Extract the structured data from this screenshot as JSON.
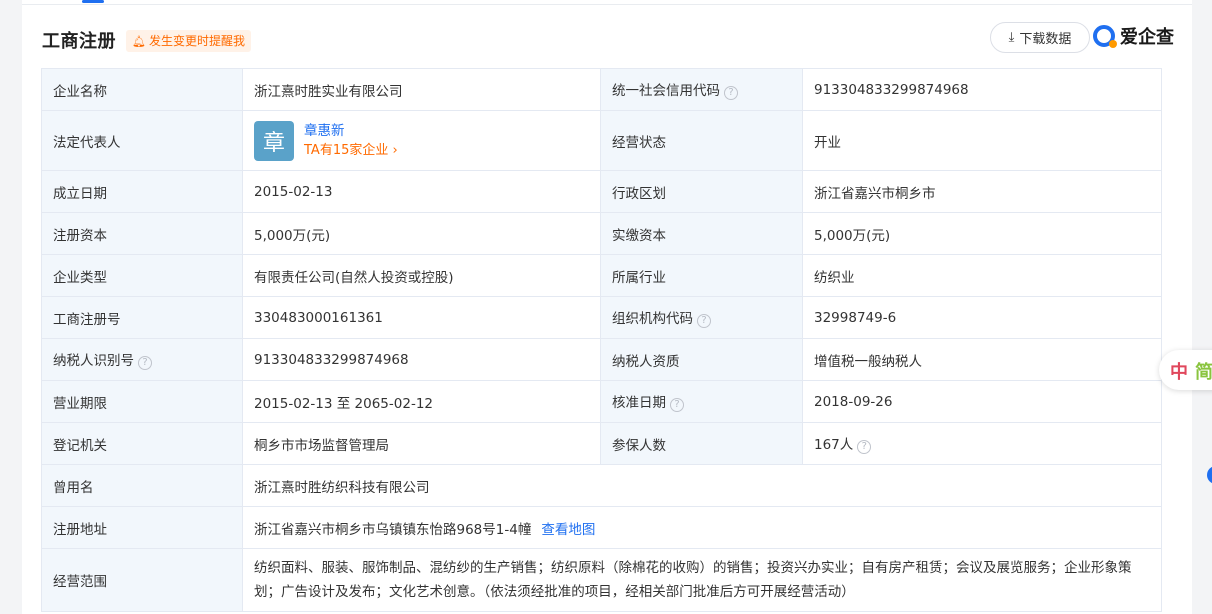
{
  "header": {
    "title": "工商注册",
    "remind": "发生变更时提醒我",
    "download": "下载数据",
    "brand": "爱企查"
  },
  "rows": {
    "company_name": {
      "label": "企业名称",
      "value": "浙江熹时胜实业有限公司"
    },
    "credit_code": {
      "label": "统一社会信用代码",
      "value": "913304833299874968"
    },
    "legal_rep": {
      "label": "法定代表人",
      "avatar_char": "章",
      "name": "章惠新",
      "ta": "TA有15家企业"
    },
    "status": {
      "label": "经营状态",
      "value": "开业"
    },
    "established": {
      "label": "成立日期",
      "value": "2015-02-13"
    },
    "region": {
      "label": "行政区划",
      "value": "浙江省嘉兴市桐乡市"
    },
    "reg_capital": {
      "label": "注册资本",
      "value": "5,000万(元)"
    },
    "paid_capital": {
      "label": "实缴资本",
      "value": "5,000万(元)"
    },
    "company_type": {
      "label": "企业类型",
      "value": "有限责任公司(自然人投资或控股)"
    },
    "industry": {
      "label": "所属行业",
      "value": "纺织业"
    },
    "reg_no": {
      "label": "工商注册号",
      "value": "330483000161361"
    },
    "org_code": {
      "label": "组织机构代码",
      "value": "32998749-6"
    },
    "taxpayer_id": {
      "label": "纳税人识别号",
      "value": "913304833299874968"
    },
    "taxpayer_qual": {
      "label": "纳税人资质",
      "value": "增值税一般纳税人"
    },
    "biz_term": {
      "label": "营业期限",
      "value": "2015-02-13 至 2065-02-12"
    },
    "approval_date": {
      "label": "核准日期",
      "value": "2018-09-26"
    },
    "authority": {
      "label": "登记机关",
      "value": "桐乡市市场监督管理局"
    },
    "insured": {
      "label": "参保人数",
      "value": "167人"
    },
    "former_name": {
      "label": "曾用名",
      "value": "浙江熹时胜纺织科技有限公司"
    },
    "address": {
      "label": "注册地址",
      "value": "浙江省嘉兴市桐乡市乌镇镇东怡路968号1-4幢",
      "map_link": "查看地图"
    },
    "scope": {
      "label": "经营范围",
      "value": "纺织面料、服装、服饰制品、混纺纱的生产销售；纺织原料（除棉花的收购）的销售；投资兴办实业；自有房产租赁；会议及展览服务；企业形象策划；广告设计及发布；文化艺术创意。（依法须经批准的项目，经相关部门批准后方可开展经营活动）"
    }
  },
  "float_widget": {
    "char1": "中",
    "char2": "简"
  },
  "colors": {
    "accent": "#1f6ff0",
    "orange": "#ff6a00",
    "label_bg": "#f2f7fc",
    "border": "#e4e9f2"
  }
}
